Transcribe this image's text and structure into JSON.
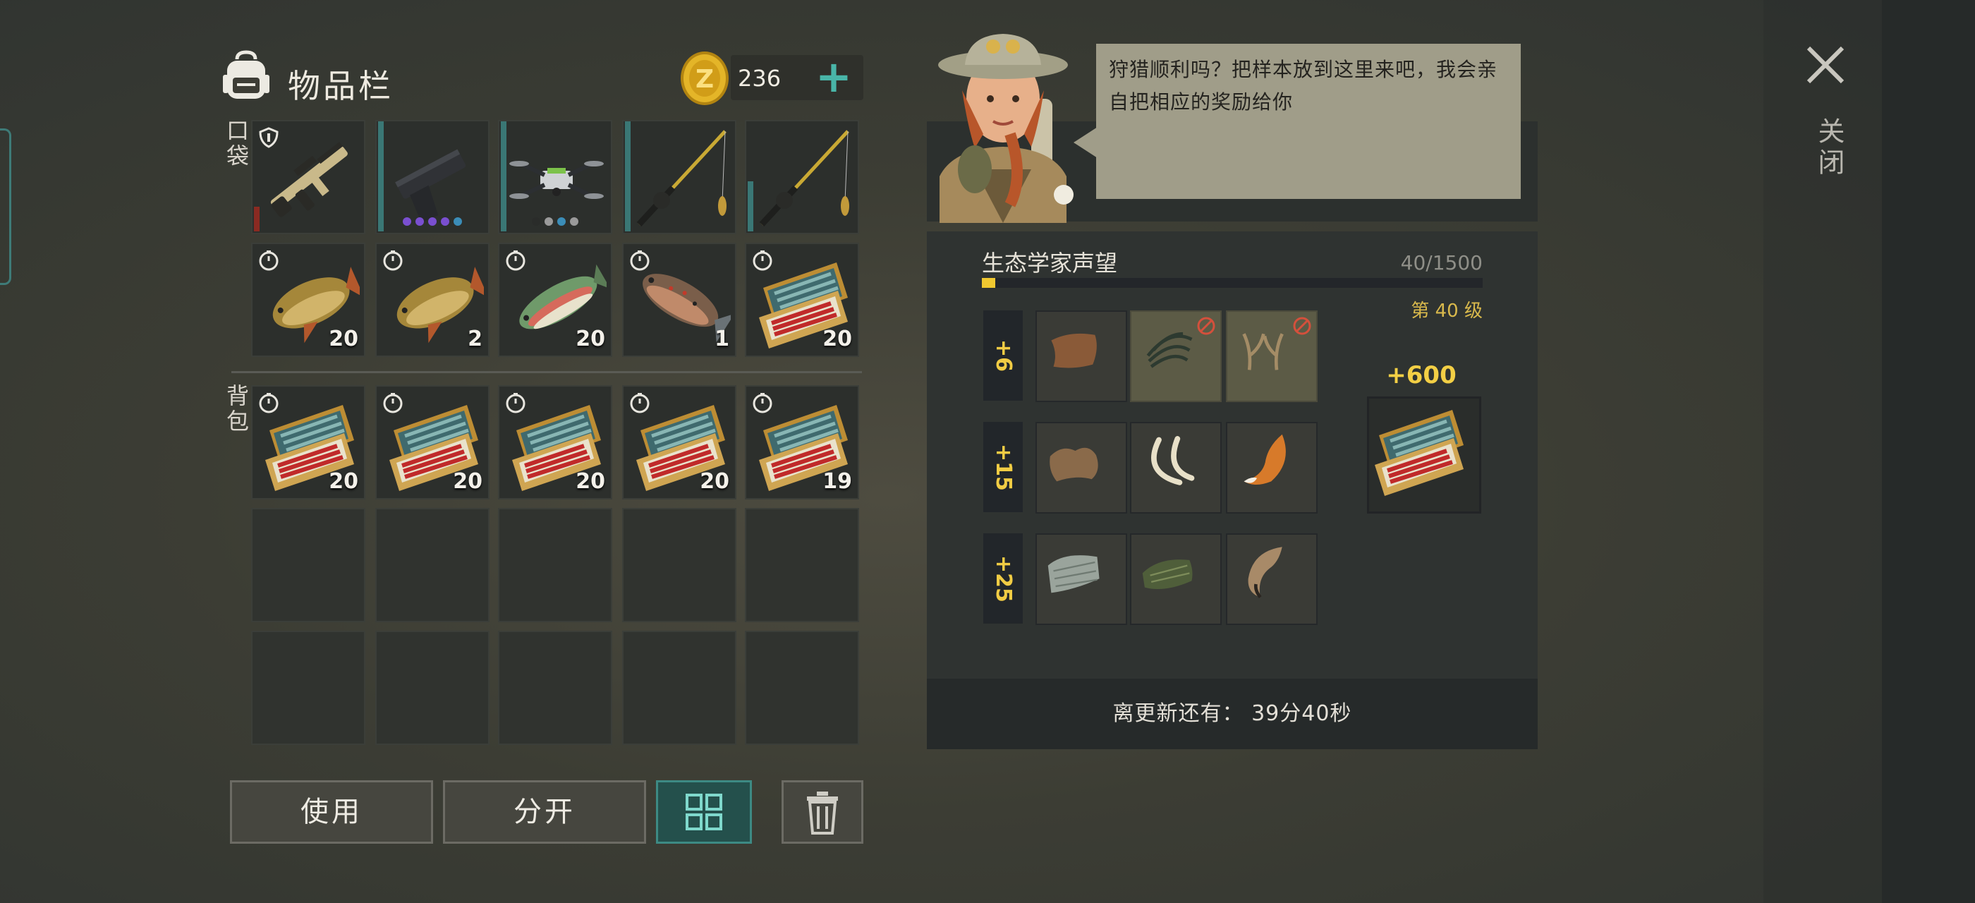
{
  "header": {
    "title": "物品栏",
    "coins": "236"
  },
  "sections": {
    "pocket": "口袋",
    "backpack": "背包"
  },
  "pocket_row1": [
    {
      "icon": "assault-rifle-icon",
      "durability": 0.22,
      "durability_color": "#8a2a22"
    },
    {
      "icon": "pistol-icon",
      "durability": 1.0,
      "dots": [
        "#7a4fd0",
        "#7a4fd0",
        "#7a4fd0",
        "#7a4fd0",
        "#3b8db8"
      ]
    },
    {
      "icon": "drone-icon",
      "durability": 1.0,
      "dots": [
        "#2a2c2a",
        "#9a9a9a",
        "#3b8db8",
        "#9a9a9a"
      ]
    },
    {
      "icon": "fishing-rod-icon",
      "durability": 1.0
    },
    {
      "icon": "fishing-rod-icon",
      "durability": 0.45
    }
  ],
  "pocket_row2": [
    {
      "icon": "carp-icon",
      "qty": "20"
    },
    {
      "icon": "carp-icon",
      "qty": "2"
    },
    {
      "icon": "salmon-icon",
      "qty": "20"
    },
    {
      "icon": "trout-icon",
      "qty": "1"
    },
    {
      "icon": "ammo-case-icon",
      "qty": "20"
    }
  ],
  "backpack_row1": [
    {
      "icon": "ammo-case-icon",
      "qty": "20"
    },
    {
      "icon": "ammo-case-icon",
      "qty": "20"
    },
    {
      "icon": "ammo-case-icon",
      "qty": "20"
    },
    {
      "icon": "ammo-case-icon",
      "qty": "20"
    },
    {
      "icon": "ammo-case-icon",
      "qty": "19"
    }
  ],
  "buttons": {
    "use": "使用",
    "split": "分开"
  },
  "npc": {
    "dialog": "狩猎顺利吗？把样本放到这里来吧，我会亲自把相应的奖励给你"
  },
  "reputation": {
    "title": "生态学家声望",
    "value": "40/1500",
    "progress": 0.027,
    "level": "第 40 级",
    "tiers": [
      {
        "points": "+6",
        "items": [
          "leather-icon",
          "feather-bundle-icon",
          "antler-icon"
        ],
        "dim": [
          false,
          true,
          true
        ]
      },
      {
        "points": "+15",
        "items": [
          "fur-pelt-icon",
          "tusk-icon",
          "fox-tail-icon"
        ],
        "dim": [
          false,
          false,
          false
        ]
      },
      {
        "points": "+25",
        "items": [
          "snake-skin-icon",
          "scale-hide-icon",
          "horn-icon"
        ],
        "dim": [
          false,
          false,
          false
        ]
      }
    ],
    "reward": "+600",
    "reward_icon": "ammo-case-icon"
  },
  "refresh": {
    "text": "离更新还有：  39分40秒"
  },
  "close": {
    "label": "关闭"
  },
  "colors": {
    "accent": "#49b5a8",
    "gold": "#f3cf45",
    "bubble": "#a09d89"
  }
}
